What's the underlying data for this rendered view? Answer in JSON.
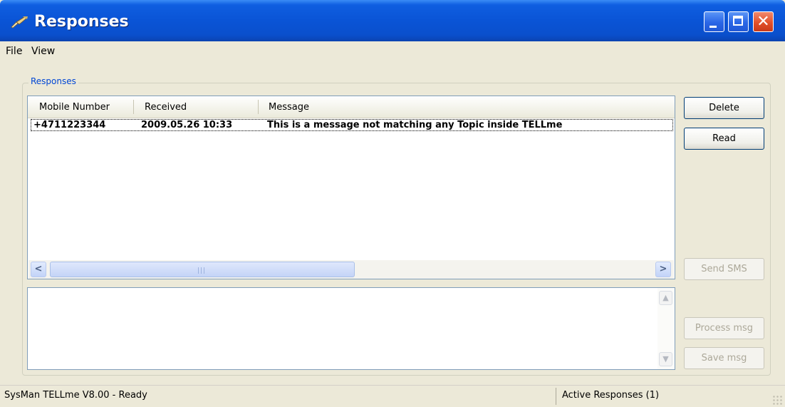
{
  "window": {
    "title": "Responses"
  },
  "menu": {
    "items": [
      "File",
      "View"
    ]
  },
  "group": {
    "label": "Responses"
  },
  "list": {
    "columns": [
      "Mobile Number",
      "Received",
      "Message"
    ],
    "rows": [
      {
        "mobile": "+4711223344",
        "received": "2009.05.26 10:33",
        "message": "This is a message not matching any Topic inside TELLme"
      }
    ]
  },
  "buttons": {
    "delete": "Delete",
    "read": "Read",
    "send_sms": "Send SMS",
    "process_msg": "Process msg",
    "save_msg": "Save msg"
  },
  "message_box": {
    "value": ""
  },
  "status": {
    "left": "SysMan TELLme V8.00 - Ready",
    "right": "Active Responses (1)"
  },
  "colors": {
    "titlebar": "#0a54d6",
    "group_label": "#0046d5",
    "close_button": "#e2502b"
  },
  "icons": [
    "app-icon",
    "minimize-icon",
    "maximize-icon",
    "close-icon",
    "scroll-left-icon",
    "scroll-right-icon",
    "scroll-up-icon",
    "scroll-down-icon",
    "resize-grip-icon"
  ]
}
